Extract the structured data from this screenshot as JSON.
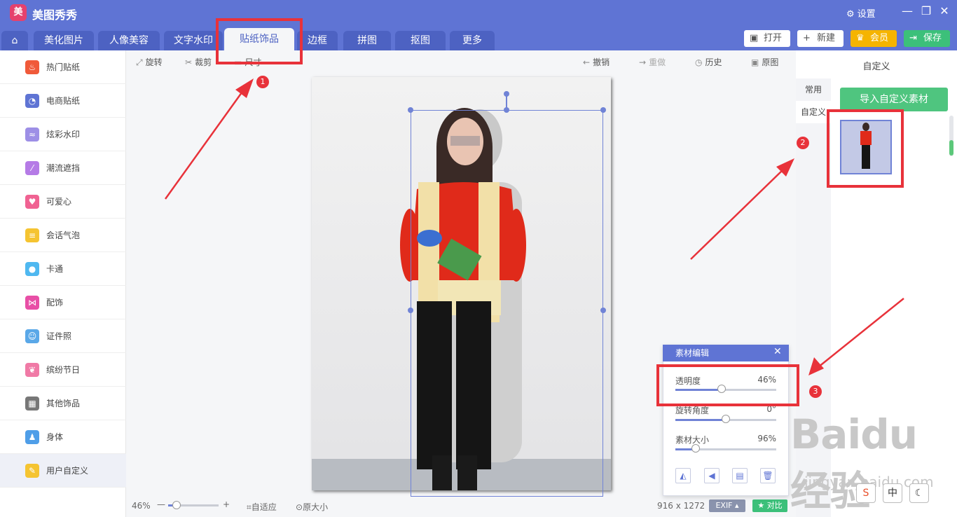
{
  "app": {
    "title": "美图秀秀",
    "logo": "美"
  },
  "titlebar": {
    "settings_label": "设置",
    "minimize": "—",
    "restore": "❐",
    "close": "✕"
  },
  "tabs": [
    {
      "label": "美化图片"
    },
    {
      "label": "人像美容"
    },
    {
      "label": "文字水印"
    },
    {
      "label": "贴纸饰品"
    },
    {
      "label": "边框"
    },
    {
      "label": "拼图"
    },
    {
      "label": "抠图"
    },
    {
      "label": "更多"
    }
  ],
  "topbuttons": {
    "open": "打开",
    "new": "新建",
    "vip": "会员",
    "save": "保存"
  },
  "sidebar": {
    "items": [
      {
        "label": "热门贴纸",
        "icon": "fire-icon",
        "color": "#f05a3a"
      },
      {
        "label": "电商贴纸",
        "icon": "cart-icon",
        "color": "#5f74d4"
      },
      {
        "label": "炫彩水印",
        "icon": "wave-icon",
        "color": "#9d8fe6"
      },
      {
        "label": "潮流遮挡",
        "icon": "stripe-icon",
        "color": "#b57be6"
      },
      {
        "label": "可爱心",
        "icon": "heart-icon",
        "color": "#f06292"
      },
      {
        "label": "会话气泡",
        "icon": "chat-bubble-icon",
        "color": "#f5c431"
      },
      {
        "label": "卡通",
        "icon": "bear-icon",
        "color": "#4fb8f0"
      },
      {
        "label": "配饰",
        "icon": "bow-icon",
        "color": "#e84fa6"
      },
      {
        "label": "证件照",
        "icon": "id-photo-icon",
        "color": "#5aa8e8"
      },
      {
        "label": "缤纷节日",
        "icon": "balloon-icon",
        "color": "#f07aa6"
      },
      {
        "label": "其他饰品",
        "icon": "grid-icon",
        "color": "#777777"
      },
      {
        "label": "身体",
        "icon": "person-icon",
        "color": "#4f9ee8"
      },
      {
        "label": "用户自定义",
        "icon": "pencil-icon",
        "color": "#f5c431"
      }
    ]
  },
  "toolbar": {
    "rotate": "旋转",
    "crop": "裁剪",
    "size": "尺寸",
    "undo": "撤销",
    "redo": "重做",
    "history": "历史",
    "original": "原图"
  },
  "statusbar": {
    "zoom": "46%",
    "zoom_minus": "—",
    "zoom_plus": "+",
    "fit": "自适应",
    "actual": "原大小",
    "dimensions": "916 x 1272",
    "exif": "EXIF",
    "compare": "对比"
  },
  "rightpanel": {
    "title": "自定义",
    "tab_common": "常用",
    "tab_custom": "自定义",
    "import_button": "导入自定义素材"
  },
  "editor": {
    "title": "素材编辑",
    "opacity_label": "透明度",
    "opacity_value": "46%",
    "opacity": 0.46,
    "rotation_label": "旋转角度",
    "rotation_value": "0°",
    "rotation": 0.5,
    "size_label": "素材大小",
    "size_value": "96%",
    "size": 0.2
  },
  "annotations": {
    "step1": "1",
    "step2": "2",
    "step3": "3"
  },
  "watermark": {
    "brand": "Bai",
    "brand2": "du",
    "cn": "经验",
    "url": "jingyan.baidu.com"
  },
  "ime": {
    "sogou": "S",
    "lang": "中",
    "moon": "☾"
  }
}
